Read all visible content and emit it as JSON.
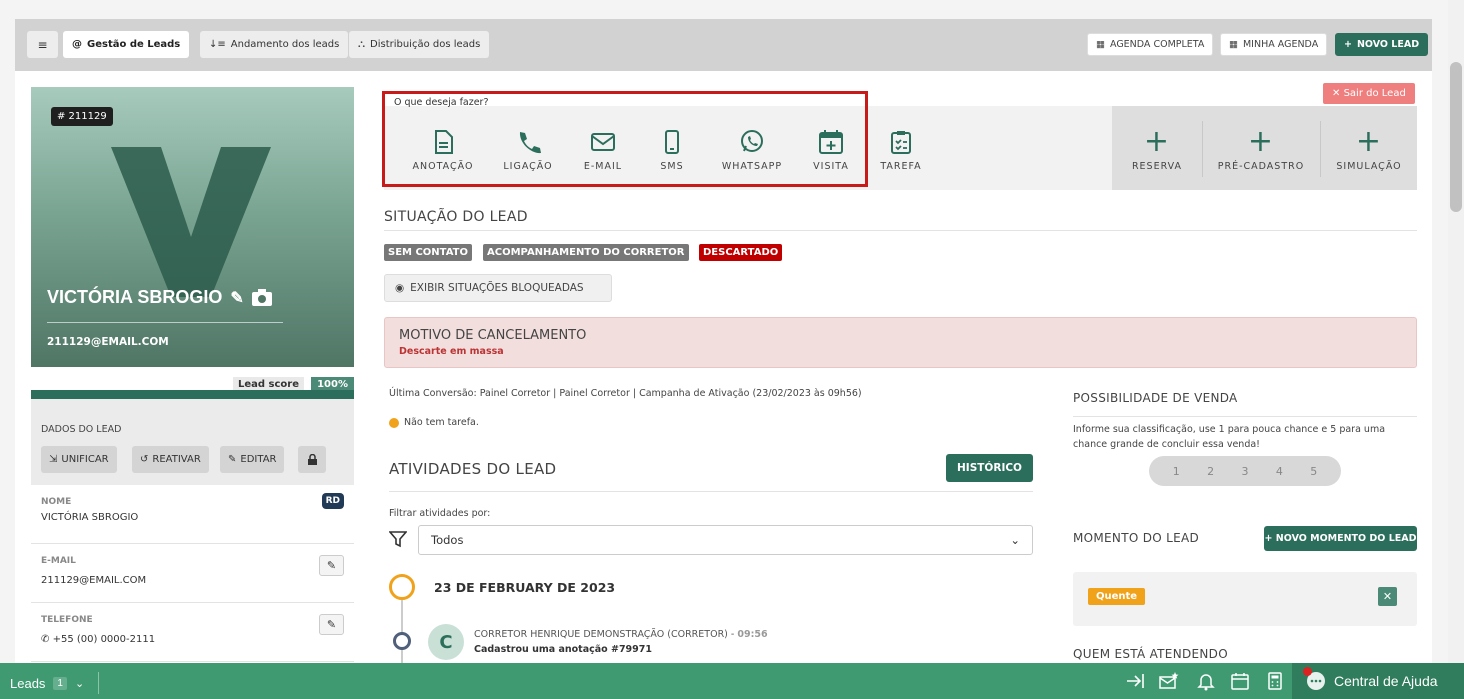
{
  "tabs": [
    {
      "label": "Gestão de Leads",
      "icon": "at-icon"
    },
    {
      "label": "Andamento dos leads",
      "icon": "sort-icon"
    },
    {
      "label": "Distribuição dos leads",
      "icon": "sitemap-icon"
    }
  ],
  "top_right": {
    "agenda_completa": "AGENDA COMPLETA",
    "minha_agenda": "MINHA AGENDA",
    "novo_lead": "NOVO LEAD"
  },
  "lead": {
    "id": "# 211129",
    "name": "VICTÓRIA SBROGIO",
    "email": "211129@EMAIL.COM",
    "score_label": "Lead score",
    "score_value": "100%"
  },
  "dados": {
    "title": "DADOS DO LEAD",
    "unificar": "UNIFICAR",
    "reativar": "REATIVAR",
    "editar": "EDITAR"
  },
  "fields": {
    "nome_label": "NOME",
    "nome_value": "VICTÓRIA SBROGIO",
    "rd": "RD",
    "email_label": "E-MAIL",
    "email_value": "211129@EMAIL.COM",
    "telefone_label": "TELEFONE",
    "telefone_value": "+55 (00) 0000-2111"
  },
  "actions": {
    "question": "O que deseja fazer?",
    "items": [
      "ANOTAÇÃO",
      "LIGAÇÃO",
      "E-MAIL",
      "SMS",
      "WHATSAPP",
      "VISITA",
      "TAREFA"
    ],
    "right": [
      "RESERVA",
      "PRÉ-CADASTRO",
      "SIMULAÇÃO"
    ],
    "sair": "Sair do Lead"
  },
  "situacao": {
    "title": "SITUAÇÃO DO LEAD",
    "tags": [
      "SEM CONTATO",
      "ACOMPANHAMENTO DO CORRETOR",
      "DESCARTADO"
    ],
    "exibir": "EXIBIR SITUAÇÕES BLOQUEADAS"
  },
  "motivo": {
    "title": "MOTIVO DE CANCELAMENTO",
    "subtitle": "Descarte em massa"
  },
  "conversao": "Última Conversão: Painel Corretor | Painel Corretor | Campanha de Ativação (23/02/2023 às 09h56)",
  "tarefa": "Não tem tarefa.",
  "atividades": {
    "title": "ATIVIDADES DO LEAD",
    "historico": "HISTÓRICO",
    "filtrar": "Filtrar atividades por:",
    "select": "Todos",
    "date": "23 DE FEBRUARY DE 2023",
    "avatar": "C",
    "author": "CORRETOR HENRIQUE DEMONSTRAÇÃO (CORRETOR)",
    "sep": " - ",
    "time": "09:56",
    "desc": "Cadastrou uma anotação #79971"
  },
  "venda": {
    "title": "POSSIBILIDADE DE VENDA",
    "desc": "Informe sua classificação, use 1 para pouca chance e 5 para uma chance grande de concluir essa venda!",
    "ratings": [
      "1",
      "2",
      "3",
      "4",
      "5"
    ]
  },
  "momento": {
    "title": "MOMENTO DO LEAD",
    "novo": "NOVO MOMENTO DO LEAD",
    "tag": "Quente"
  },
  "quem": "QUEM ESTÁ ATENDENDO",
  "bottom": {
    "leads": "Leads",
    "count": "1",
    "help": "Central de Ajuda"
  },
  "colors": {
    "brand": "#2c6e5c",
    "bottom": "#3f9a72",
    "highlight": "#c91a1a",
    "descartado": "#c00000",
    "quente": "#f0a21b"
  }
}
